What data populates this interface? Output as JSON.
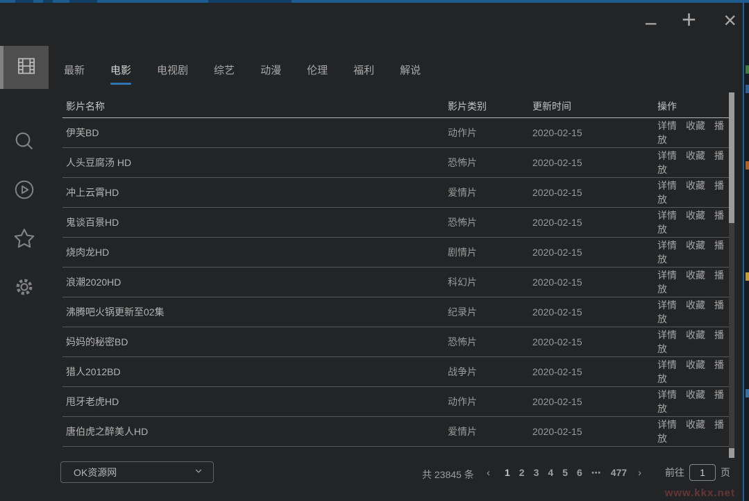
{
  "window": {
    "minimize_glyph": "−",
    "maximize_glyph": "+",
    "close_glyph": "×"
  },
  "accent_color": "#3176b4",
  "sidebar": {
    "items": [
      {
        "id": "library",
        "icon": "film-grid-icon",
        "active": true
      },
      {
        "id": "search",
        "icon": "search-icon",
        "active": false
      },
      {
        "id": "player",
        "icon": "play-circle-icon",
        "active": false
      },
      {
        "id": "favorites",
        "icon": "star-icon",
        "active": false
      },
      {
        "id": "settings",
        "icon": "gear-icon",
        "active": false
      }
    ]
  },
  "tabs": {
    "items": [
      {
        "id": "latest",
        "label": "最新",
        "active": false
      },
      {
        "id": "movie",
        "label": "电影",
        "active": true
      },
      {
        "id": "tv",
        "label": "电视剧",
        "active": false
      },
      {
        "id": "variety",
        "label": "综艺",
        "active": false
      },
      {
        "id": "anime",
        "label": "动漫",
        "active": false
      },
      {
        "id": "ethics",
        "label": "伦理",
        "active": false
      },
      {
        "id": "welfare",
        "label": "福利",
        "active": false
      },
      {
        "id": "comment",
        "label": "解说",
        "active": false
      }
    ]
  },
  "table": {
    "headers": [
      "影片名称",
      "影片类别",
      "更新时间",
      "操作"
    ],
    "actions": [
      "详情",
      "收藏",
      "播放"
    ],
    "rows": [
      {
        "name": "伊芙BD",
        "category": "动作片",
        "updated": "2020-02-15"
      },
      {
        "name": "人头豆腐汤 HD",
        "category": "恐怖片",
        "updated": "2020-02-15"
      },
      {
        "name": "冲上云霄HD",
        "category": "爱情片",
        "updated": "2020-02-15"
      },
      {
        "name": "鬼谈百景HD",
        "category": "恐怖片",
        "updated": "2020-02-15"
      },
      {
        "name": "烧肉龙HD",
        "category": "剧情片",
        "updated": "2020-02-15"
      },
      {
        "name": "浪潮2020HD",
        "category": "科幻片",
        "updated": "2020-02-15"
      },
      {
        "name": "沸腾吧火锅更新至02集",
        "category": "纪录片",
        "updated": "2020-02-15"
      },
      {
        "name": "妈妈的秘密BD",
        "category": "恐怖片",
        "updated": "2020-02-15"
      },
      {
        "name": "猎人2012BD",
        "category": "战争片",
        "updated": "2020-02-15"
      },
      {
        "name": "甩牙老虎HD",
        "category": "动作片",
        "updated": "2020-02-15"
      },
      {
        "name": "唐伯虎之醉美人HD",
        "category": "爱情片",
        "updated": "2020-02-15"
      }
    ]
  },
  "footer": {
    "source_select": {
      "value": "OK资源网"
    },
    "total": "共 23845 条",
    "prev": "‹",
    "next": "›",
    "pages": [
      "1",
      "2",
      "3",
      "4",
      "5",
      "6",
      "⋯",
      "477"
    ],
    "active_page": "1",
    "goto_label": "前往",
    "goto_value": "1",
    "page_unit": "页"
  },
  "watermark": "www.kkx.net"
}
